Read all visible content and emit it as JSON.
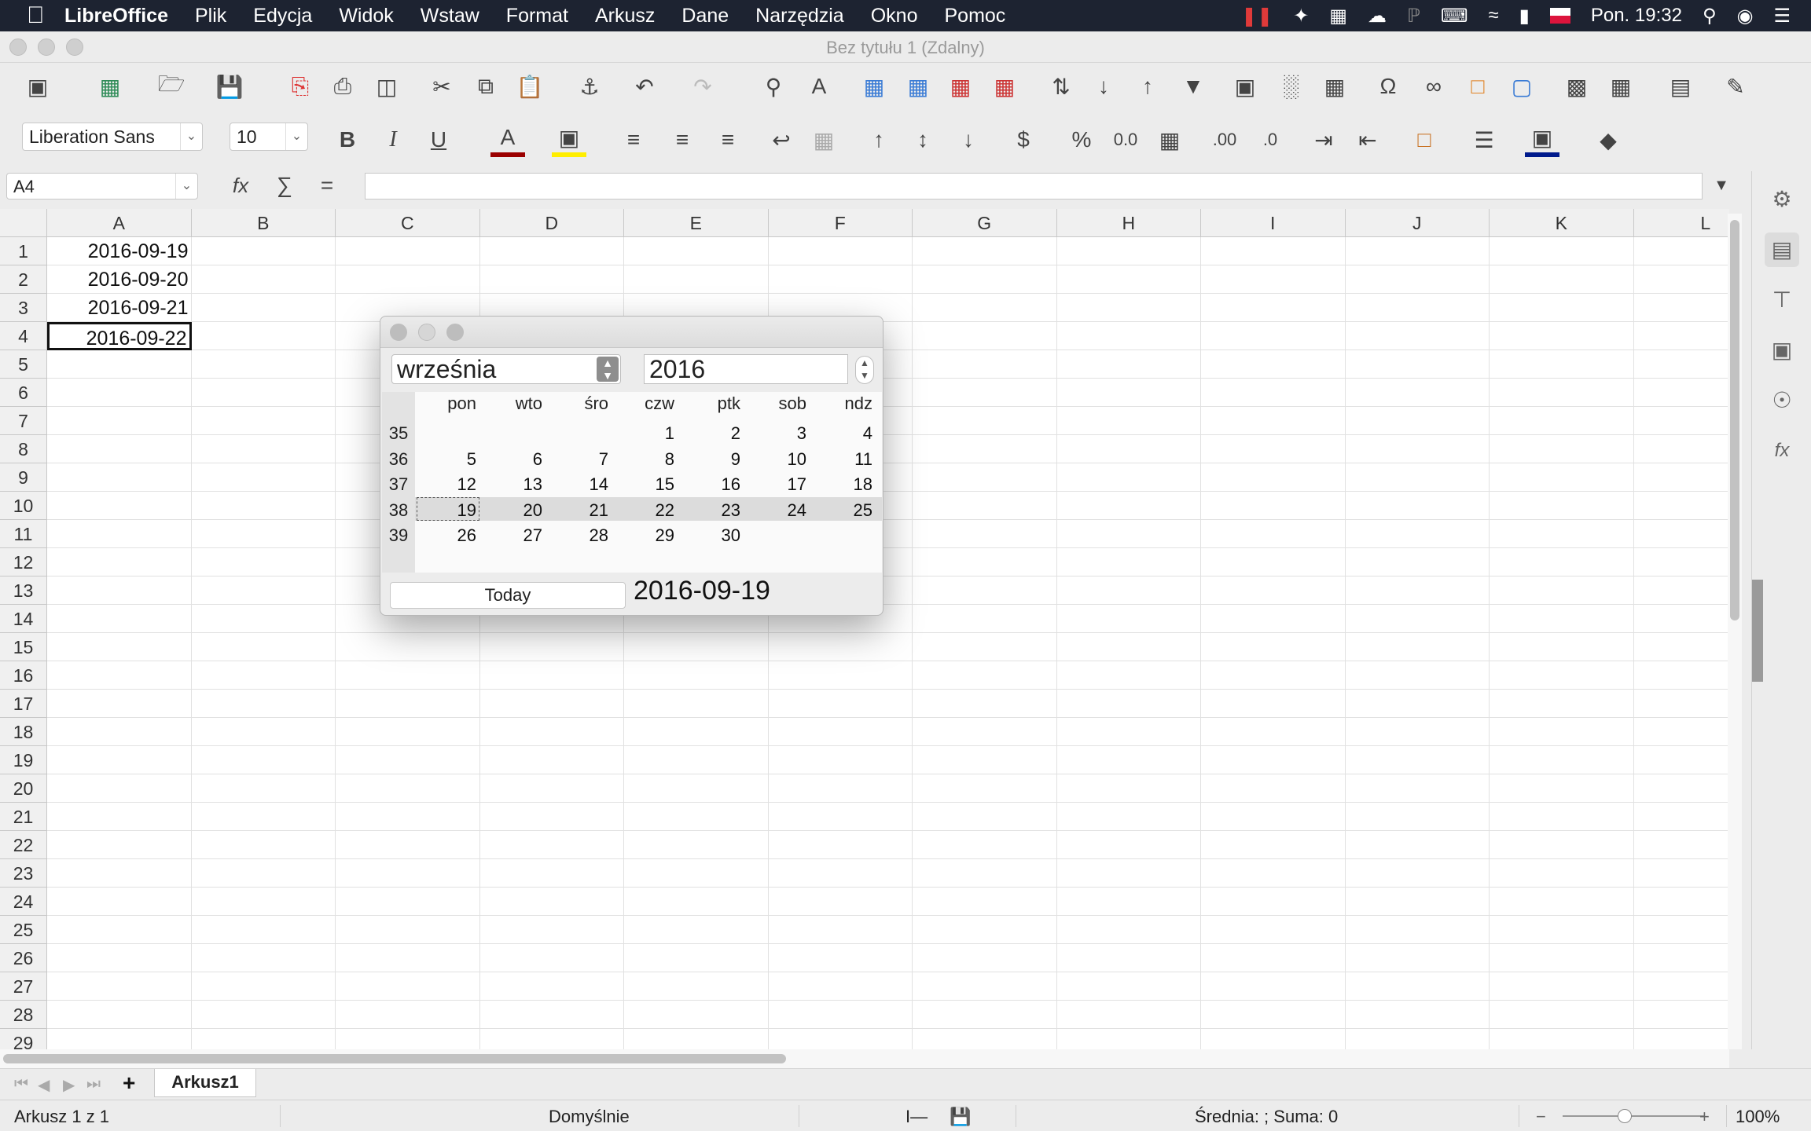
{
  "menubar": {
    "app": "LibreOffice",
    "items": [
      "Plik",
      "Edycja",
      "Widok",
      "Wstaw",
      "Format",
      "Arkusz",
      "Dane",
      "Narzędzia",
      "Okno",
      "Pomoc"
    ],
    "clock": "Pon. 19:32"
  },
  "window": {
    "title": "Bez tytułu 1 (Zdalny)"
  },
  "formatting": {
    "font_name": "Liberation Sans",
    "font_size": "10"
  },
  "formula": {
    "name_box": "A4",
    "content": ""
  },
  "sheet": {
    "columns": [
      "A",
      "B",
      "C",
      "D",
      "E",
      "F",
      "G",
      "H",
      "I",
      "J",
      "K",
      "L"
    ],
    "rows": [
      "1",
      "2",
      "3",
      "4",
      "5",
      "6",
      "7",
      "8",
      "9",
      "10",
      "11",
      "12",
      "13",
      "14",
      "15",
      "16",
      "17",
      "18",
      "19",
      "20",
      "21",
      "22",
      "23",
      "24",
      "25",
      "26",
      "27",
      "28",
      "29"
    ],
    "cells": {
      "A1": "2016-09-19",
      "A2": "2016-09-20",
      "A3": "2016-09-21",
      "A4": "2016-09-22"
    },
    "active_cell": "A4"
  },
  "calendar": {
    "month": "września",
    "year": "2016",
    "weekdays": [
      "pon",
      "wto",
      "śro",
      "czw",
      "ptk",
      "sob",
      "ndz"
    ],
    "weeks": [
      {
        "num": "35",
        "days": [
          "",
          "",
          "",
          "1",
          "2",
          "3",
          "4"
        ]
      },
      {
        "num": "36",
        "days": [
          "5",
          "6",
          "7",
          "8",
          "9",
          "10",
          "11"
        ]
      },
      {
        "num": "37",
        "days": [
          "12",
          "13",
          "14",
          "15",
          "16",
          "17",
          "18"
        ]
      },
      {
        "num": "38",
        "days": [
          "19",
          "20",
          "21",
          "22",
          "23",
          "24",
          "25"
        ]
      },
      {
        "num": "39",
        "days": [
          "26",
          "27",
          "28",
          "29",
          "30",
          "",
          ""
        ]
      }
    ],
    "today_button": "Today",
    "selected_date": "2016-09-19"
  },
  "tabs": {
    "sheet_name": "Arkusz1"
  },
  "status": {
    "sheet_info": "Arkusz 1 z 1",
    "page_style": "Domyślnie",
    "summary": "Średnia: ; Suma: 0",
    "zoom": "100%"
  }
}
